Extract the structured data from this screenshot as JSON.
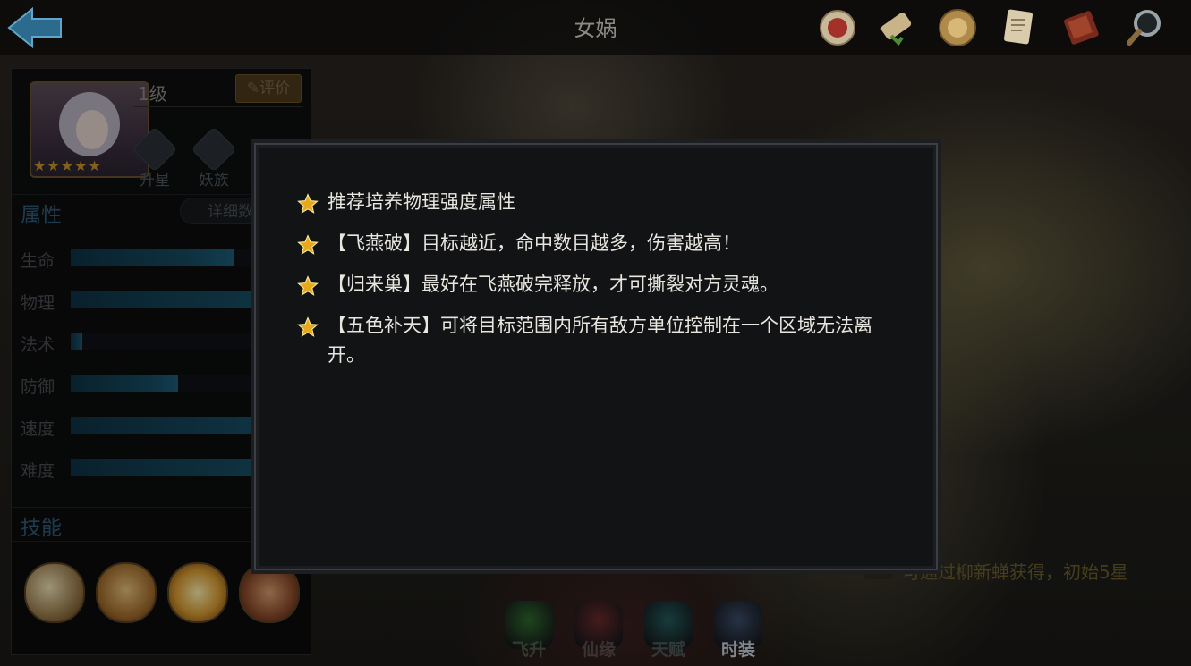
{
  "header": {
    "title": "女娲",
    "icons": [
      "seal-icon",
      "scroll-icon",
      "medallion-icon",
      "document-icon",
      "book-icon",
      "magnifier-icon"
    ]
  },
  "hero": {
    "level": "1级",
    "rate_label": "评价",
    "stars": "★★★★★",
    "star_count": 5,
    "badges": [
      {
        "label": "升星",
        "icon": "star-badge-icon"
      },
      {
        "label": "妖族",
        "icon": "race-badge-icon"
      }
    ]
  },
  "attributes": {
    "title": "属性",
    "detail_label": "详细数",
    "items": [
      {
        "label": "生命",
        "percent": 70
      },
      {
        "label": "物理",
        "percent": 100
      },
      {
        "label": "法术",
        "percent": 5
      },
      {
        "label": "防御",
        "percent": 46
      },
      {
        "label": "速度",
        "percent": 100
      },
      {
        "label": "难度",
        "percent": 100
      }
    ]
  },
  "skills": {
    "title": "技能",
    "icons": [
      "skill-1-icon",
      "skill-2-icon",
      "skill-3-icon",
      "skill-4-icon"
    ]
  },
  "bottom_tabs": [
    {
      "label": "飞升",
      "color": "#2f6a2d",
      "text_color": "#4f5b49"
    },
    {
      "label": "仙缘",
      "color": "#6b2b2b",
      "text_color": "#5c4e4e"
    },
    {
      "label": "天赋",
      "color": "#245b5c",
      "text_color": "#4c5858"
    },
    {
      "label": "时装",
      "color": "#3b4d6a",
      "text_color": "#c9d0da"
    }
  ],
  "hint": "可通过柳新蝉获得，初始5星",
  "tips": {
    "items": [
      "推荐培养物理强度属性",
      "【飞燕破】目标越近，命中数目越多，伤害越高！",
      "【归来巢】最好在飞燕破完释放，才可撕裂对方灵魂。",
      "【五色补天】可将目标范围内所有敌方单位控制在一个区域无法离开。"
    ]
  },
  "colors": {
    "accent_blue": "#2f5d7c",
    "star_gold": "#e8a81e",
    "modal_bg": "#111315"
  }
}
